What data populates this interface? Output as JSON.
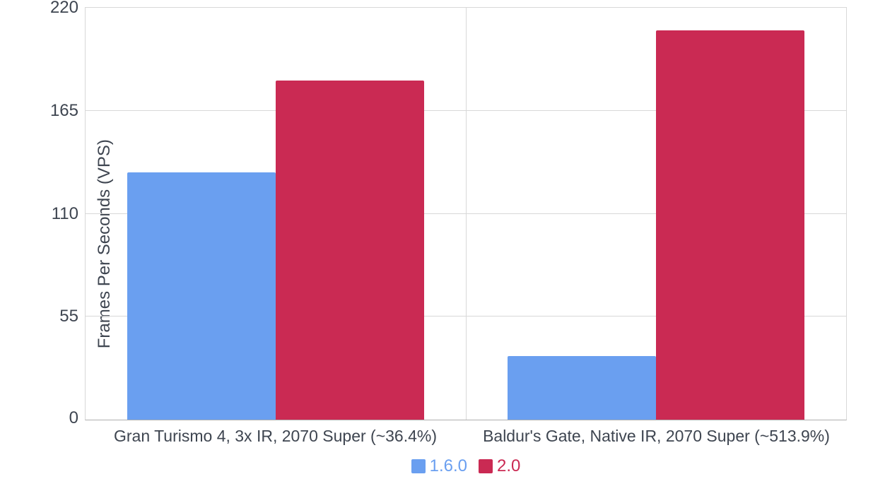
{
  "chart_data": {
    "type": "bar",
    "ylabel": "Frames Per Seconds (VPS)",
    "xlabel": "",
    "title": "",
    "ylim": [
      0,
      220
    ],
    "yticks": [
      0,
      55,
      110,
      165,
      220
    ],
    "categories": [
      "Gran Turismo 4, 3x IR, 2070 Super (~36.4%)",
      "Baldur's Gate, Native IR, 2070 Super (~513.9%)"
    ],
    "series": [
      {
        "name": "1.6.0",
        "color": "#6a9ff0",
        "values": [
          132,
          34
        ]
      },
      {
        "name": "2.0",
        "color": "#ca2a53",
        "values": [
          181,
          208
        ]
      }
    ]
  },
  "colors": {
    "series0": "#6a9ff0",
    "series1": "#ca2a53"
  }
}
